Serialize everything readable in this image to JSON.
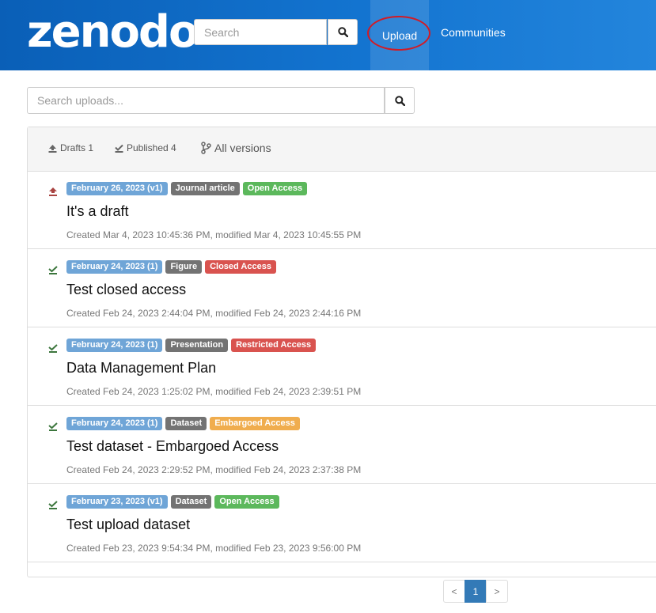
{
  "header": {
    "logo": "zenodo",
    "search_placeholder": "Search",
    "nav": {
      "upload": "Upload",
      "communities": "Communities"
    },
    "colors": {
      "bar": "#1374d0",
      "highlight_ring": "#d21b25"
    }
  },
  "uploads_search": {
    "placeholder": "Search uploads..."
  },
  "filters": {
    "drafts": "Drafts 1",
    "published": "Published 4",
    "all_versions": "All versions"
  },
  "items": [
    {
      "status_icon": "upload-icon",
      "date": "February 26, 2023 (v1)",
      "type": "Journal article",
      "access": "Open Access",
      "title": "It's a draft",
      "meta": "Created Mar 4, 2023 10:45:36 PM, modified Mar 4, 2023 10:45:55 PM"
    },
    {
      "status_icon": "check-icon",
      "date": "February 24, 2023 (1)",
      "type": "Figure",
      "access": "Closed Access",
      "title": "Test closed access",
      "meta": "Created Feb 24, 2023 2:44:04 PM, modified Feb 24, 2023 2:44:16 PM"
    },
    {
      "status_icon": "check-icon",
      "date": "February 24, 2023 (1)",
      "type": "Presentation",
      "access": "Restricted Access",
      "title": "Data Management Plan",
      "meta": "Created Feb 24, 2023 1:25:02 PM, modified Feb 24, 2023 2:39:51 PM"
    },
    {
      "status_icon": "check-icon",
      "date": "February 24, 2023 (1)",
      "type": "Dataset",
      "access": "Embargoed Access",
      "title": "Test dataset - Embargoed Access",
      "meta": "Created Feb 24, 2023 2:29:52 PM, modified Feb 24, 2023 2:37:38 PM"
    },
    {
      "status_icon": "check-icon",
      "date": "February 23, 2023 (v1)",
      "type": "Dataset",
      "access": "Open Access",
      "title": "Test upload dataset",
      "meta": "Created Feb 23, 2023 9:54:34 PM, modified Feb 23, 2023 9:56:00 PM"
    }
  ],
  "pagination": {
    "prev": "<",
    "current": "1",
    "next": ">"
  }
}
